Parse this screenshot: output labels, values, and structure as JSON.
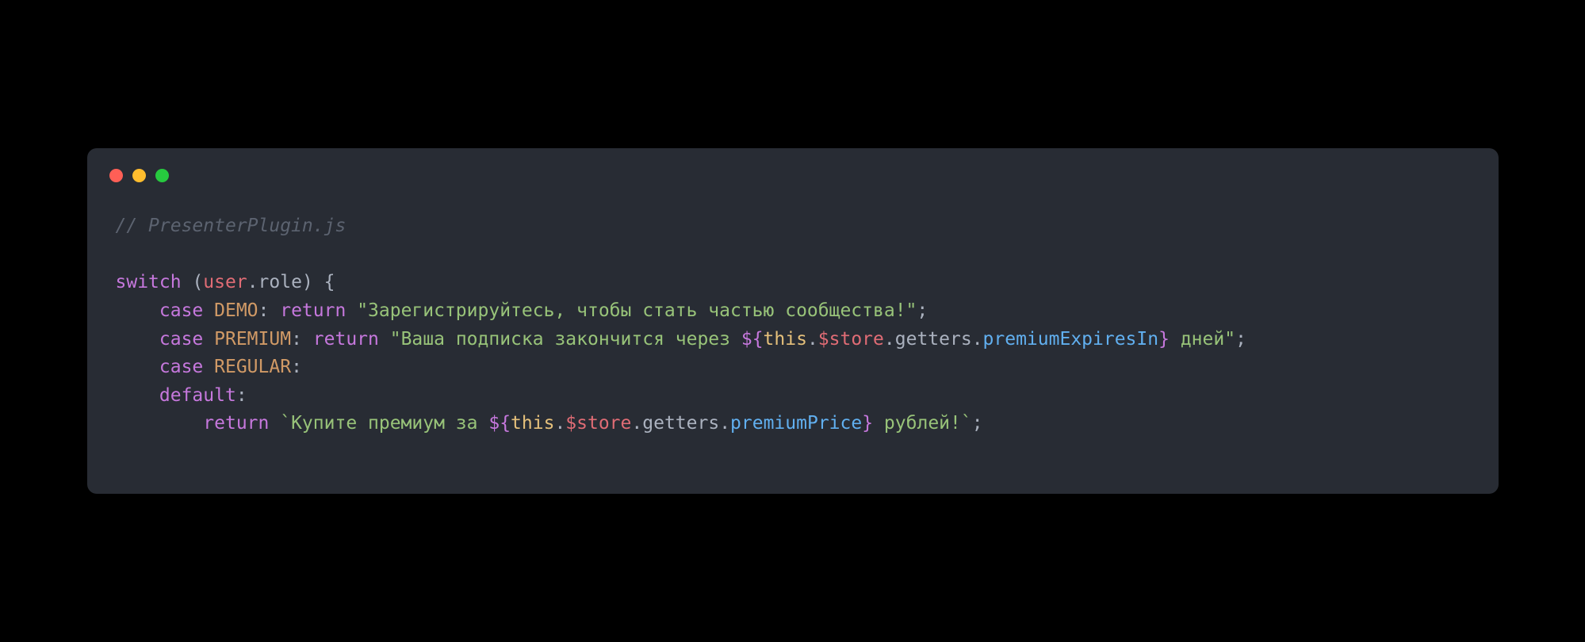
{
  "window": {
    "dots": [
      "red",
      "yellow",
      "green"
    ]
  },
  "code": {
    "comment": "// PresenterPlugin.js",
    "l1": {
      "switch": "switch",
      "lparen": " (",
      "user": "user",
      "dot": ".",
      "role": "role",
      "rparen_brace": ") {"
    },
    "l2": {
      "indent": "    ",
      "case": "case",
      "sp": " ",
      "DEMO": "DEMO",
      "colon_sp": ": ",
      "return": "return",
      "sp2": " ",
      "str": "\"Зарегистрируйтесь, чтобы стать частью сообщества!\"",
      "semi": ";"
    },
    "l3": {
      "indent": "    ",
      "case": "case",
      "sp": " ",
      "PREMIUM": "PREMIUM",
      "colon_sp": ": ",
      "return": "return",
      "sp2": " ",
      "str1": "\"Ваша подписка закончится через ",
      "tpl_open": "${",
      "this": "this",
      "d1": ".",
      "store": "$store",
      "d2": ".",
      "getters": "getters",
      "d3": ".",
      "prop": "premiumExpiresIn",
      "tpl_close": "}",
      "str2": " дней\"",
      "semi": ";"
    },
    "l4": {
      "indent": "    ",
      "case": "case",
      "sp": " ",
      "REGULAR": "REGULAR",
      "colon": ":"
    },
    "l5": {
      "indent": "    ",
      "default": "default",
      "colon": ":"
    },
    "l6": {
      "indent": "        ",
      "return": "return",
      "sp": " ",
      "bt1": "`Купите премиум за ",
      "tpl_open": "${",
      "this": "this",
      "d1": ".",
      "store": "$store",
      "d2": ".",
      "getters": "getters",
      "d3": ".",
      "prop": "premiumPrice",
      "tpl_close": "}",
      "bt2": " рублей!`",
      "semi": ";"
    }
  }
}
